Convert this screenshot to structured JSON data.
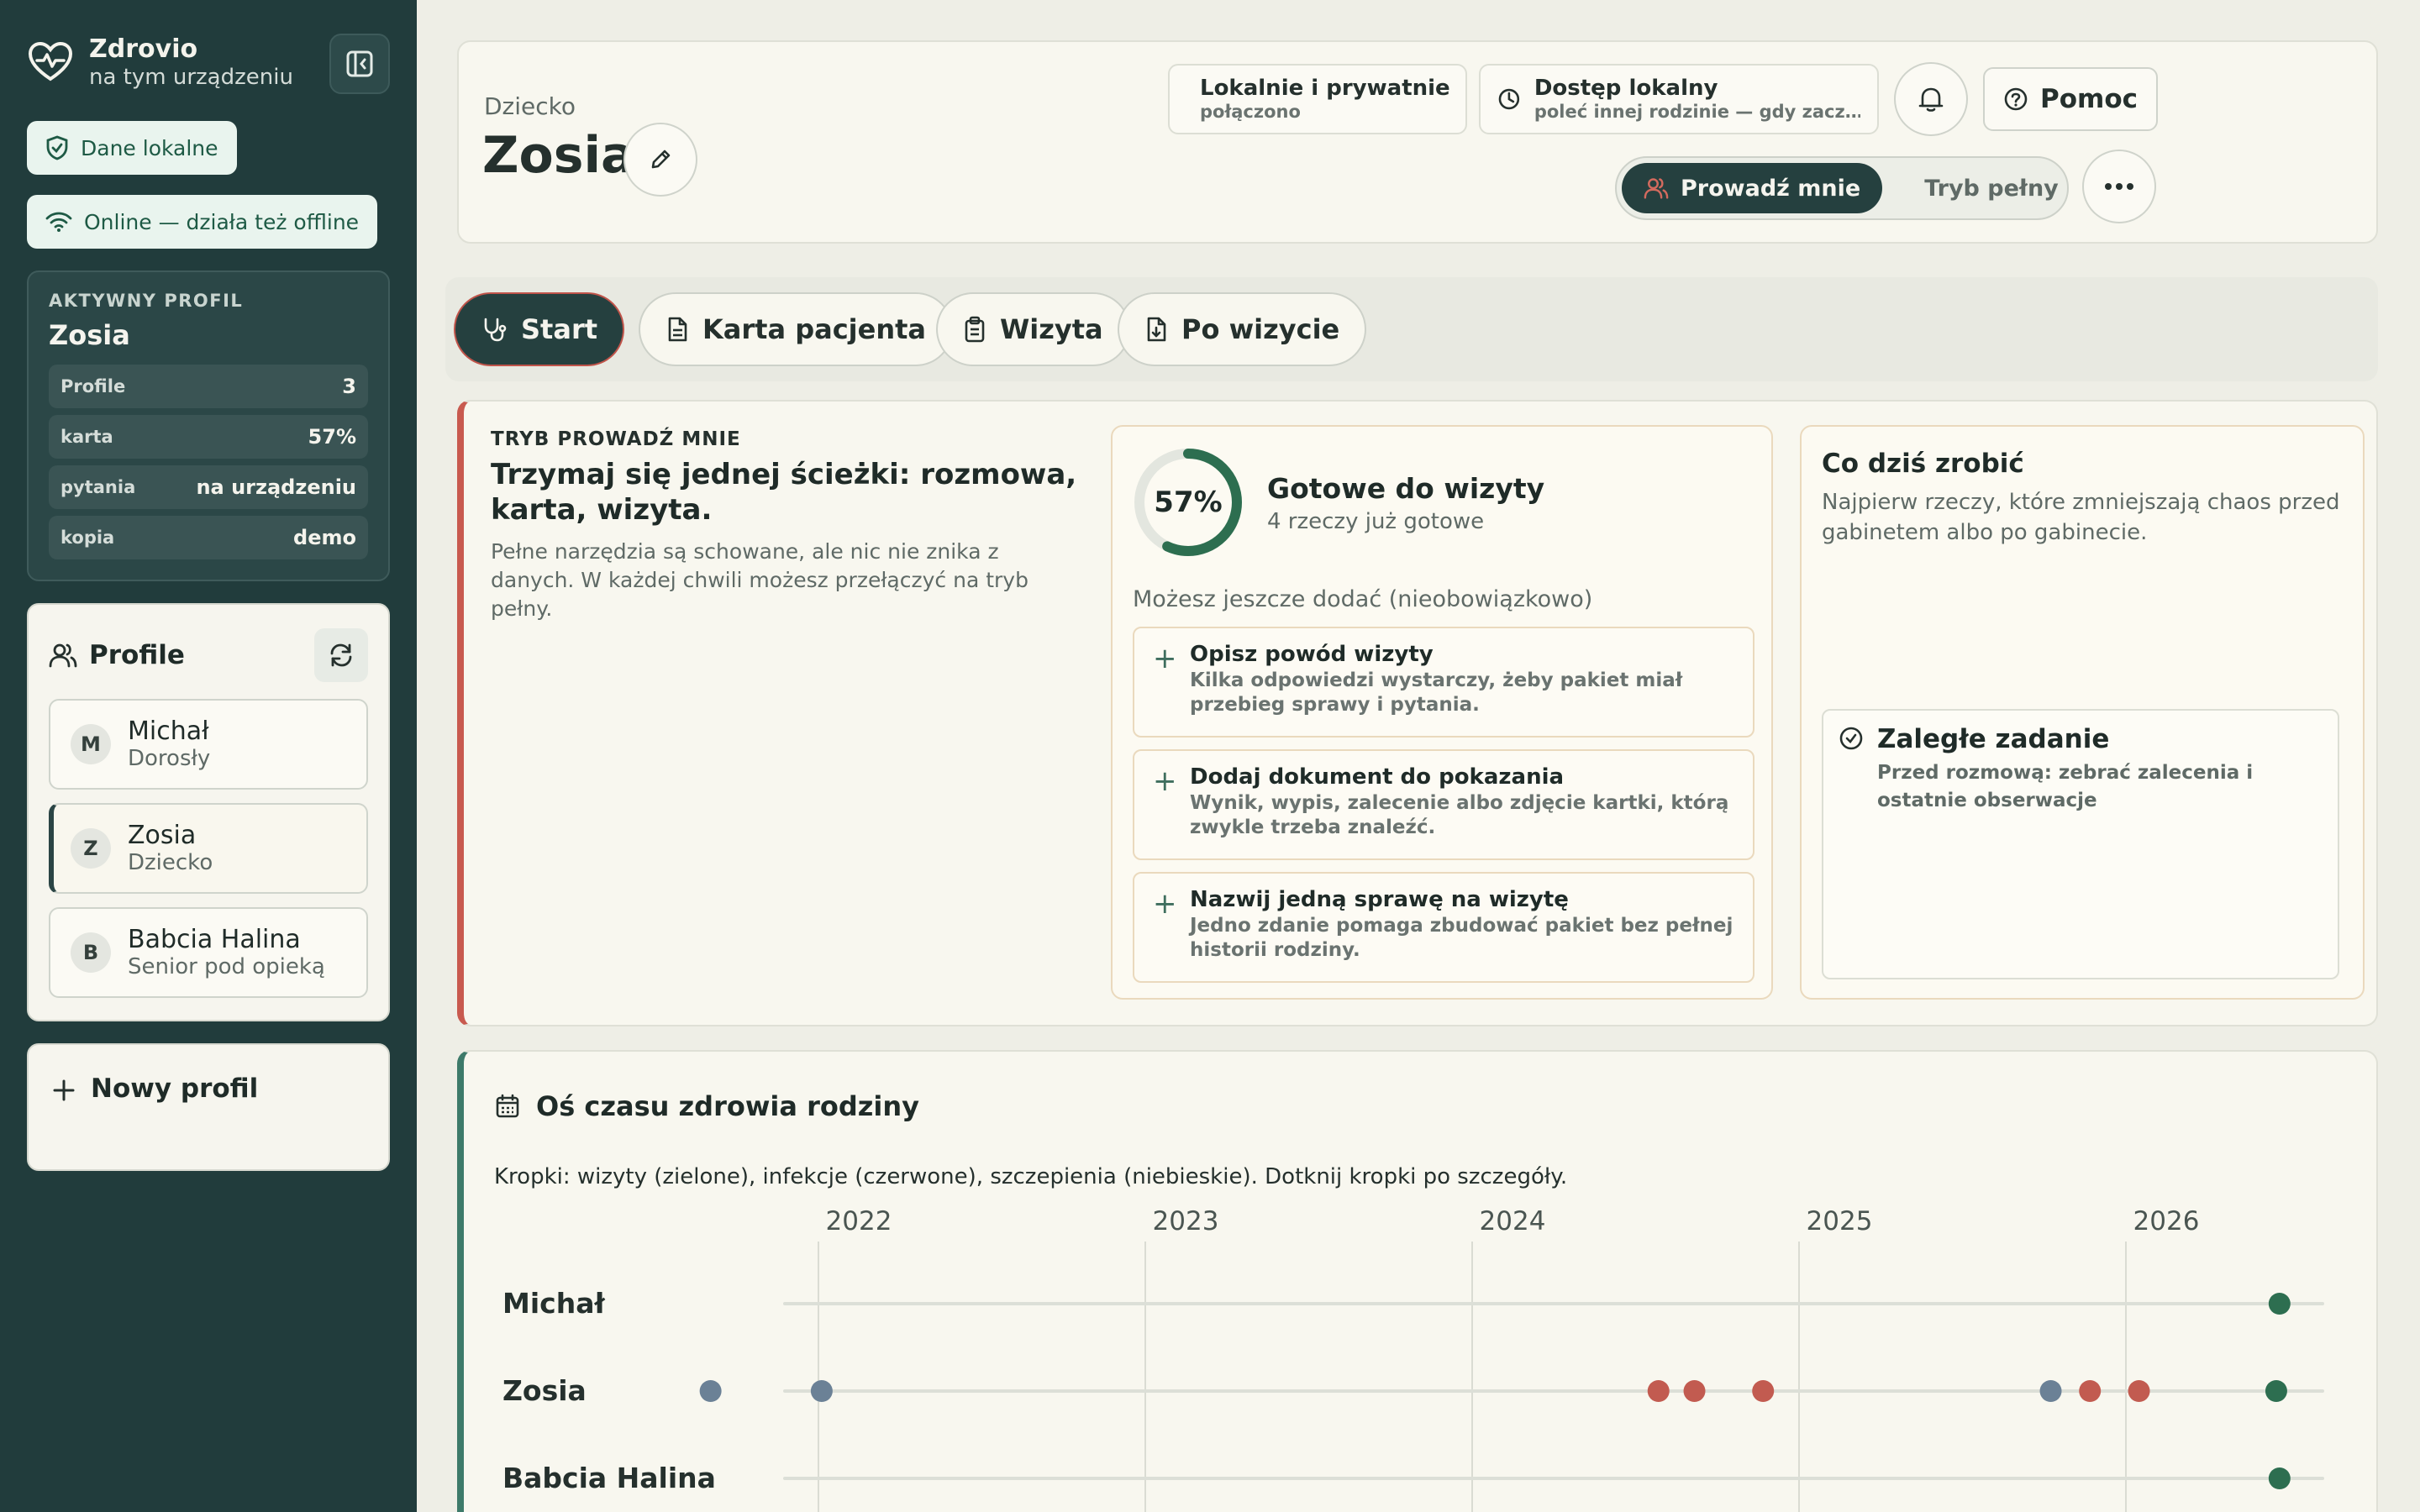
{
  "brand": {
    "name": "Zdrovio",
    "subtitle": "na tym urządzeniu"
  },
  "chips": {
    "local": "Dane lokalne",
    "online": "Online — działa też offline"
  },
  "active_profile": {
    "label": "AKTYWNY PROFIL",
    "name": "Zosia",
    "stats": [
      {
        "key": "Profile",
        "value": "3"
      },
      {
        "key": "karta",
        "value": "57%"
      },
      {
        "key": "pytania",
        "value": "na urządzeniu"
      },
      {
        "key": "kopia",
        "value": "demo"
      }
    ]
  },
  "profiles": {
    "title": "Profile",
    "items": [
      {
        "initial": "M",
        "name": "Michał",
        "role": "Dorosły"
      },
      {
        "initial": "Z",
        "name": "Zosia",
        "role": "Dziecko"
      },
      {
        "initial": "B",
        "name": "Babcia Halina",
        "role": "Senior pod opieką"
      }
    ]
  },
  "new_profile": {
    "label": "Nowy profil"
  },
  "header": {
    "subtitle": "Dziecko",
    "title": "Zosia",
    "status_local": {
      "title": "Lokalnie i prywatnie",
      "sub": "połączono"
    },
    "status_access": {
      "title": "Dostęp lokalny",
      "sub": "poleć innej rodzinie — gdy zacz…"
    },
    "help": "Pomoc",
    "mode_active": "Prowadź mnie",
    "mode_inactive": "Tryb pełny"
  },
  "tabs": [
    {
      "label": "Start",
      "icon": "stethoscope-icon"
    },
    {
      "label": "Karta pacjenta",
      "icon": "document-icon"
    },
    {
      "label": "Wizyta",
      "icon": "clipboard-icon"
    },
    {
      "label": "Po wizycie",
      "icon": "file-download-icon"
    }
  ],
  "guide": {
    "label": "TRYB PROWADŹ MNIE",
    "title": "Trzymaj się jednej ścieżki: rozmowa, karta, wizyta.",
    "desc": "Pełne narzędzia są schowane, ale nic nie znika z danych. W każdej chwili możesz przełączyć na tryb pełny."
  },
  "ready": {
    "percent_label": "57%",
    "percent": 57,
    "title": "Gotowe do wizyty",
    "sub": "4 rzeczy już gotowe",
    "optional_label": "Możesz jeszcze dodać (nieobowiązkowo)",
    "items": [
      {
        "title": "Opisz powód wizyty",
        "desc": "Kilka odpowiedzi wystarczy, żeby pakiet miał przebieg sprawy i pytania."
      },
      {
        "title": "Dodaj dokument do pokazania",
        "desc": "Wynik, wypis, zalecenie albo zdjęcie kartki, którą zwykle trzeba znaleźć."
      },
      {
        "title": "Nazwij jedną sprawę na wizytę",
        "desc": "Jedno zdanie pomaga zbudować pakiet bez pełnej historii rodziny."
      }
    ]
  },
  "todo": {
    "title": "Co dziś zrobić",
    "desc": "Najpierw rzeczy, które zmniejszają chaos przed gabinetem albo po gabinecie.",
    "overdue_title": "Zaległe zadanie",
    "overdue_desc": "Przed rozmową: zebrać zalecenia i ostatnie obserwacje"
  },
  "timeline": {
    "title": "Oś czasu zdrowia rodziny",
    "legend": "Kropki: wizyty (zielone), infekcje (czerwone), szczepienia (niebieskie). Dotknij kropki po szczegóły.",
    "years": [
      "2022",
      "2023",
      "2024",
      "2025",
      "2026"
    ],
    "colors": {
      "visit": "#2d6e50",
      "infection": "#c25b50",
      "vaccination": "#6b8196"
    },
    "rows": [
      {
        "name": "Michał",
        "events": [
          {
            "t": 2026.47,
            "type": "visit"
          }
        ]
      },
      {
        "name": "Zosia",
        "events": [
          {
            "t": 2021.67,
            "type": "vaccination"
          },
          {
            "t": 2022.01,
            "type": "vaccination"
          },
          {
            "t": 2024.57,
            "type": "infection"
          },
          {
            "t": 2024.68,
            "type": "infection"
          },
          {
            "t": 2024.89,
            "type": "infection"
          },
          {
            "t": 2025.77,
            "type": "vaccination"
          },
          {
            "t": 2025.89,
            "type": "infection"
          },
          {
            "t": 2026.04,
            "type": "infection"
          },
          {
            "t": 2026.46,
            "type": "visit"
          }
        ]
      },
      {
        "name": "Babcia Halina",
        "events": [
          {
            "t": 2026.47,
            "type": "visit"
          }
        ]
      }
    ]
  }
}
